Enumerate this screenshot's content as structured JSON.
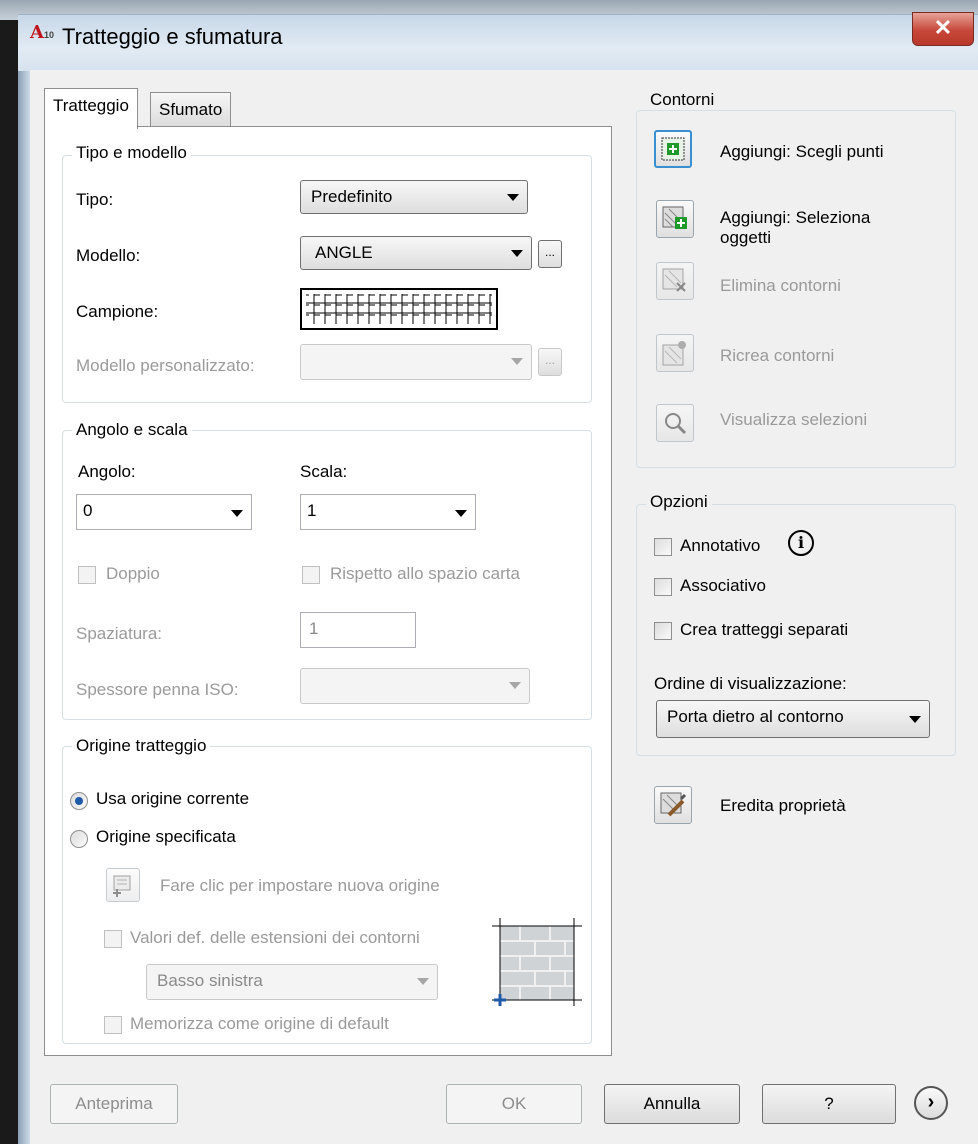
{
  "window": {
    "title": "Tratteggio e sfumatura",
    "app_icon": "A",
    "app_icon_sub": "10"
  },
  "tabs": [
    "Tratteggio",
    "Sfumato"
  ],
  "tipo_modello": {
    "legend": "Tipo e modello",
    "tipo_label": "Tipo:",
    "tipo_value": "Predefinito",
    "modello_label": "Modello:",
    "modello_value": "ANGLE",
    "campione_label": "Campione:",
    "personalizzato_label": "Modello personalizzato:",
    "ellipsis": "..."
  },
  "angolo_scala": {
    "legend": "Angolo e scala",
    "angolo_label": "Angolo:",
    "angolo_value": "0",
    "scala_label": "Scala:",
    "scala_value": "1",
    "doppio": "Doppio",
    "rispetto": "Rispetto allo spazio carta",
    "spaziatura_label": "Spaziatura:",
    "spaziatura_value": "1",
    "spessore_label": "Spessore penna ISO:"
  },
  "origine": {
    "legend": "Origine tratteggio",
    "usa_corrente": "Usa origine corrente",
    "specificata": "Origine specificata",
    "fare_clic": "Fare clic per impostare nuova origine",
    "valori_def": "Valori def. delle estensioni dei contorni",
    "basso_sinistra": "Basso sinistra",
    "memorizza": "Memorizza come origine di default"
  },
  "contorni": {
    "legend": "Contorni",
    "scegli_punti": "Aggiungi: Scegli punti",
    "seleziona_oggetti": "Aggiungi: Seleziona oggetti",
    "elimina": "Elimina contorni",
    "ricrea": "Ricrea contorni",
    "visualizza": "Visualizza selezioni"
  },
  "opzioni": {
    "legend": "Opzioni",
    "annotativo": "Annotativo",
    "associativo": "Associativo",
    "crea_separati": "Crea tratteggi separati",
    "ordine_label": "Ordine di visualizzazione:",
    "ordine_value": "Porta dietro al contorno"
  },
  "eredita": "Eredita proprietà",
  "footer": {
    "anteprima": "Anteprima",
    "ok": "OK",
    "annulla": "Annulla",
    "help": "?"
  },
  "colors": {
    "accent_blue": "#1e5aa8",
    "close_red": "#c7483a",
    "icon_green": "#1f9a2a"
  }
}
